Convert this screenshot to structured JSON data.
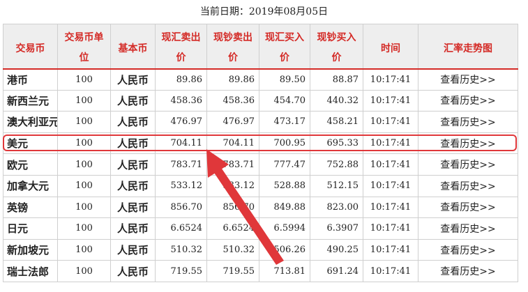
{
  "page": {
    "date_text": "当前日期：2019年08月05日"
  },
  "table": {
    "headers": [
      {
        "line1": "交易币",
        "line2": ""
      },
      {
        "line1": "交易币单",
        "line2": "位"
      },
      {
        "line1": "基本币",
        "line2": ""
      },
      {
        "line1": "现汇卖出",
        "line2": "价"
      },
      {
        "line1": "现钞卖出",
        "line2": "价"
      },
      {
        "line1": "现汇买入",
        "line2": "价"
      },
      {
        "line1": "现钞买入",
        "line2": "价"
      },
      {
        "line1": "时间",
        "line2": ""
      },
      {
        "line1": "汇率走势图",
        "line2": ""
      }
    ],
    "rows": [
      {
        "currency": "港币",
        "unit": "100",
        "base": "人民币",
        "spot_sell": "89.86",
        "cash_sell": "89.86",
        "spot_buy": "89.50",
        "cash_buy": "88.87",
        "time": "10:17:41",
        "link": "查看历史>>"
      },
      {
        "currency": "新西兰元",
        "unit": "100",
        "base": "人民币",
        "spot_sell": "458.36",
        "cash_sell": "458.36",
        "spot_buy": "454.70",
        "cash_buy": "440.32",
        "time": "10:17:41",
        "link": "查看历史>>"
      },
      {
        "currency": "澳大利亚元",
        "unit": "100",
        "base": "人民币",
        "spot_sell": "476.97",
        "cash_sell": "476.97",
        "spot_buy": "473.17",
        "cash_buy": "458.21",
        "time": "10:17:41",
        "link": "查看历史>>"
      },
      {
        "currency": "美元",
        "unit": "100",
        "base": "人民币",
        "spot_sell": "704.11",
        "cash_sell": "704.11",
        "spot_buy": "700.95",
        "cash_buy": "695.33",
        "time": "10:17:41",
        "link": "查看历史>>"
      },
      {
        "currency": "欧元",
        "unit": "100",
        "base": "人民币",
        "spot_sell": "783.71",
        "cash_sell": "783.71",
        "spot_buy": "777.47",
        "cash_buy": "752.88",
        "time": "10:17:41",
        "link": "查看历史>>"
      },
      {
        "currency": "加拿大元",
        "unit": "100",
        "base": "人民币",
        "spot_sell": "533.12",
        "cash_sell": "533.12",
        "spot_buy": "528.88",
        "cash_buy": "512.15",
        "time": "10:17:41",
        "link": "查看历史>>"
      },
      {
        "currency": "英镑",
        "unit": "100",
        "base": "人民币",
        "spot_sell": "856.70",
        "cash_sell": "856.70",
        "spot_buy": "849.88",
        "cash_buy": "823.00",
        "time": "10:17:41",
        "link": "查看历史>>"
      },
      {
        "currency": "日元",
        "unit": "100",
        "base": "人民币",
        "spot_sell": "6.6524",
        "cash_sell": "6.6524",
        "spot_buy": "6.5994",
        "cash_buy": "6.3907",
        "time": "10:17:41",
        "link": "查看历史>>"
      },
      {
        "currency": "新加坡元",
        "unit": "100",
        "base": "人民币",
        "spot_sell": "510.32",
        "cash_sell": "510.32",
        "spot_buy": "506.26",
        "cash_buy": "490.25",
        "time": "10:17:41",
        "link": "查看历史>>"
      },
      {
        "currency": "瑞士法郎",
        "unit": "100",
        "base": "人民币",
        "spot_sell": "719.55",
        "cash_sell": "719.55",
        "spot_buy": "713.81",
        "cash_buy": "691.24",
        "time": "10:17:41",
        "link": "查看历史>>"
      }
    ]
  },
  "annotation": {
    "highlighted_row": "美元",
    "color": "#e0373a"
  }
}
